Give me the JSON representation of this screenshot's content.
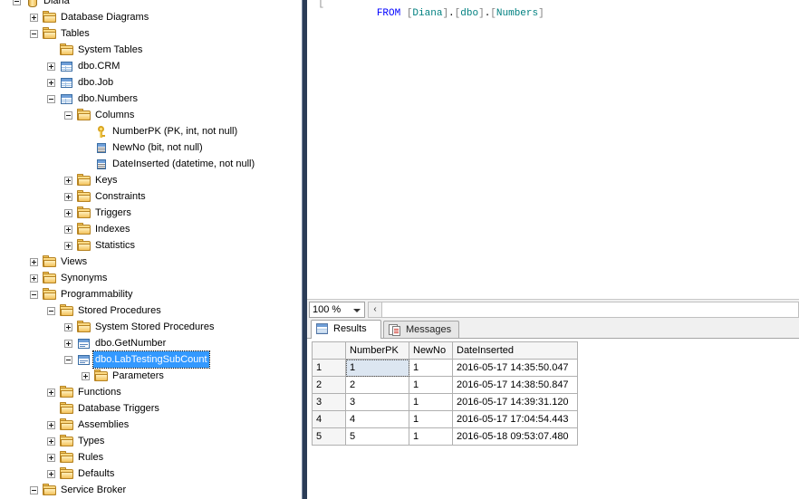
{
  "tree": {
    "name": "object-explorer",
    "nodes": [
      {
        "label": "Diana",
        "icon": "database-icon",
        "indent": 0,
        "expander": "minus",
        "selected": false
      },
      {
        "label": "Database Diagrams",
        "icon": "folder-icon",
        "indent": 1,
        "expander": "plus",
        "selected": false
      },
      {
        "label": "Tables",
        "icon": "folder-icon",
        "indent": 1,
        "expander": "minus",
        "selected": false
      },
      {
        "label": "System Tables",
        "icon": "folder-icon",
        "indent": 2,
        "expander": "none",
        "selected": false
      },
      {
        "label": "dbo.CRM",
        "icon": "table-icon",
        "indent": 2,
        "expander": "plus",
        "selected": false
      },
      {
        "label": "dbo.Job",
        "icon": "table-icon",
        "indent": 2,
        "expander": "plus",
        "selected": false
      },
      {
        "label": "dbo.Numbers",
        "icon": "table-icon",
        "indent": 2,
        "expander": "minus",
        "selected": false
      },
      {
        "label": "Columns",
        "icon": "folder-icon",
        "indent": 3,
        "expander": "minus",
        "selected": false
      },
      {
        "label": "NumberPK (PK, int, not null)",
        "icon": "key-icon",
        "indent": 4,
        "expander": "none",
        "selected": false
      },
      {
        "label": "NewNo (bit, not null)",
        "icon": "column-icon",
        "indent": 4,
        "expander": "none",
        "selected": false
      },
      {
        "label": "DateInserted (datetime, not null)",
        "icon": "column-icon",
        "indent": 4,
        "expander": "none",
        "selected": false
      },
      {
        "label": "Keys",
        "icon": "folder-icon",
        "indent": 3,
        "expander": "plus",
        "selected": false
      },
      {
        "label": "Constraints",
        "icon": "folder-icon",
        "indent": 3,
        "expander": "plus",
        "selected": false
      },
      {
        "label": "Triggers",
        "icon": "folder-icon",
        "indent": 3,
        "expander": "plus",
        "selected": false
      },
      {
        "label": "Indexes",
        "icon": "folder-icon",
        "indent": 3,
        "expander": "plus",
        "selected": false
      },
      {
        "label": "Statistics",
        "icon": "folder-icon",
        "indent": 3,
        "expander": "plus",
        "selected": false
      },
      {
        "label": "Views",
        "icon": "folder-icon",
        "indent": 1,
        "expander": "plus",
        "selected": false
      },
      {
        "label": "Synonyms",
        "icon": "folder-icon",
        "indent": 1,
        "expander": "plus",
        "selected": false
      },
      {
        "label": "Programmability",
        "icon": "folder-icon",
        "indent": 1,
        "expander": "minus",
        "selected": false
      },
      {
        "label": "Stored Procedures",
        "icon": "folder-icon",
        "indent": 2,
        "expander": "minus",
        "selected": false
      },
      {
        "label": "System Stored Procedures",
        "icon": "folder-icon",
        "indent": 3,
        "expander": "plus",
        "selected": false
      },
      {
        "label": "dbo.GetNumber",
        "icon": "stored-procedure-icon",
        "indent": 3,
        "expander": "plus",
        "selected": false
      },
      {
        "label": "dbo.LabTestingSubCount",
        "icon": "stored-procedure-icon",
        "indent": 3,
        "expander": "minus",
        "selected": true
      },
      {
        "label": "Parameters",
        "icon": "folder-icon",
        "indent": 4,
        "expander": "plus",
        "selected": false
      },
      {
        "label": "Functions",
        "icon": "folder-icon",
        "indent": 2,
        "expander": "plus",
        "selected": false
      },
      {
        "label": "Database Triggers",
        "icon": "folder-icon",
        "indent": 2,
        "expander": "none",
        "selected": false
      },
      {
        "label": "Assemblies",
        "icon": "folder-icon",
        "indent": 2,
        "expander": "plus",
        "selected": false
      },
      {
        "label": "Types",
        "icon": "folder-icon",
        "indent": 2,
        "expander": "plus",
        "selected": false
      },
      {
        "label": "Rules",
        "icon": "folder-icon",
        "indent": 2,
        "expander": "plus",
        "selected": false
      },
      {
        "label": "Defaults",
        "icon": "folder-icon",
        "indent": 2,
        "expander": "plus",
        "selected": false
      },
      {
        "label": "Service Broker",
        "icon": "folder-icon",
        "indent": 1,
        "expander": "minus",
        "selected": false
      }
    ]
  },
  "editor": {
    "sql_keyword": "FROM",
    "sql_rest": " [Diana].[dbo].[Numbers]",
    "sql_full": "FROM [Diana].[dbo].[Numbers]",
    "db_name": "Diana",
    "schema_name": "dbo",
    "table_name": "Numbers",
    "margin_bracket": "["
  },
  "editor_status": {
    "zoom_value": "100 %",
    "dropdown_icon": "chevron-down-icon",
    "scroll_left_label": "‹"
  },
  "results": {
    "tabs": [
      {
        "label": "Results",
        "icon": "grid-icon",
        "active": true
      },
      {
        "label": "Messages",
        "icon": "messages-icon",
        "active": false
      }
    ],
    "grid": {
      "columns": [
        "",
        "NumberPK",
        "NewNo",
        "DateInserted"
      ],
      "rows": [
        {
          "num": "1",
          "NumberPK": "1",
          "NewNo": "1",
          "DateInserted": "2016-05-17 14:35:50.047"
        },
        {
          "num": "2",
          "NumberPK": "2",
          "NewNo": "1",
          "DateInserted": "2016-05-17 14:38:50.847"
        },
        {
          "num": "3",
          "NumberPK": "3",
          "NewNo": "1",
          "DateInserted": "2016-05-17 14:39:31.120"
        },
        {
          "num": "4",
          "NumberPK": "4",
          "NewNo": "1",
          "DateInserted": "2016-05-17 17:04:54.443"
        },
        {
          "num": "5",
          "NumberPK": "5",
          "NewNo": "1",
          "DateInserted": "2016-05-18 09:53:07.480"
        }
      ],
      "selected_cell": {
        "row": 0,
        "column": "NumberPK"
      }
    }
  },
  "colors": {
    "selection_blue": "#3399ff",
    "splitter_navy": "#2b3c57",
    "cell_selected": "#dce6f1",
    "sql_keyword": "#0000ff",
    "sql_identifier": "#008080",
    "sql_bracket": "#808080"
  }
}
